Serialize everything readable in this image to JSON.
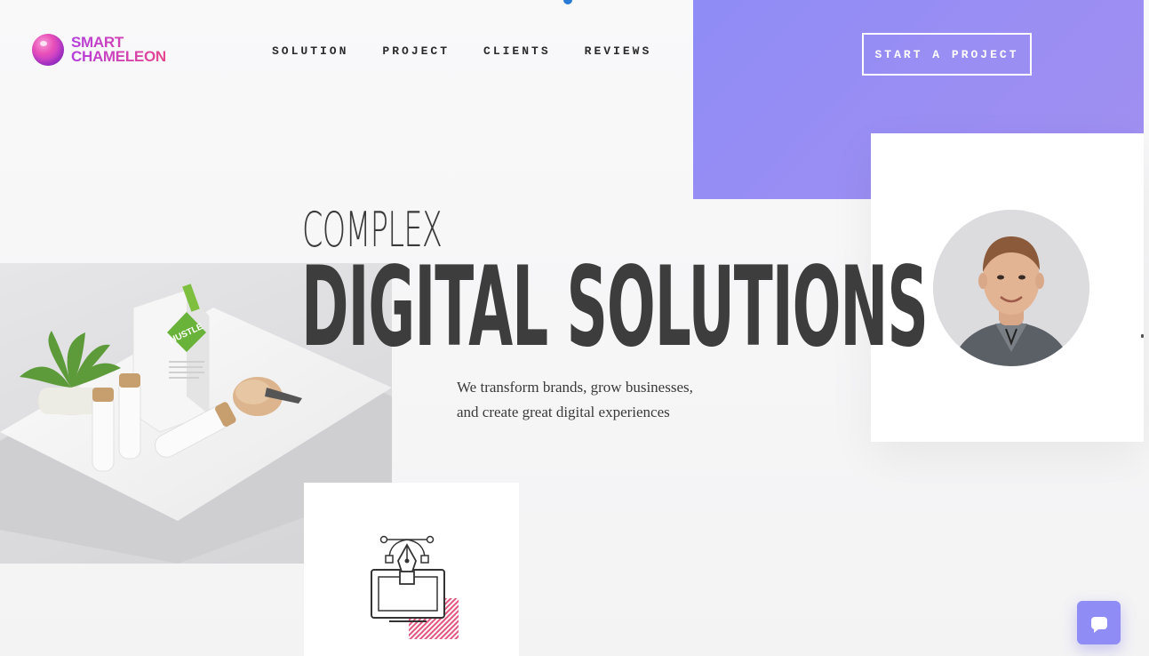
{
  "brand": {
    "line1": "SMART",
    "line2": "CHAMELEON",
    "colors": {
      "purple": "#8f8cf6",
      "pink": "#e8478f",
      "violet": "#b43fdc"
    }
  },
  "nav": {
    "items": [
      {
        "label": "SOLUTION"
      },
      {
        "label": "PROJECT"
      },
      {
        "label": "CLIENTS"
      },
      {
        "label": "REVIEWS"
      }
    ],
    "cta_label": "START A PROJECT"
  },
  "hero": {
    "title_light": "COMPLEX",
    "title_bold": "DIGITAL SOLUTIONS",
    "tagline_line1": "We transform brands, grow businesses,",
    "tagline_line2": "and create great digital experiences"
  },
  "product_image": {
    "bag_label": "HUSTLE"
  },
  "icons": {
    "logo": "chameleon-ball-logo",
    "design": "pen-tool-monitor-icon",
    "chat": "chat-bubble-icon"
  }
}
